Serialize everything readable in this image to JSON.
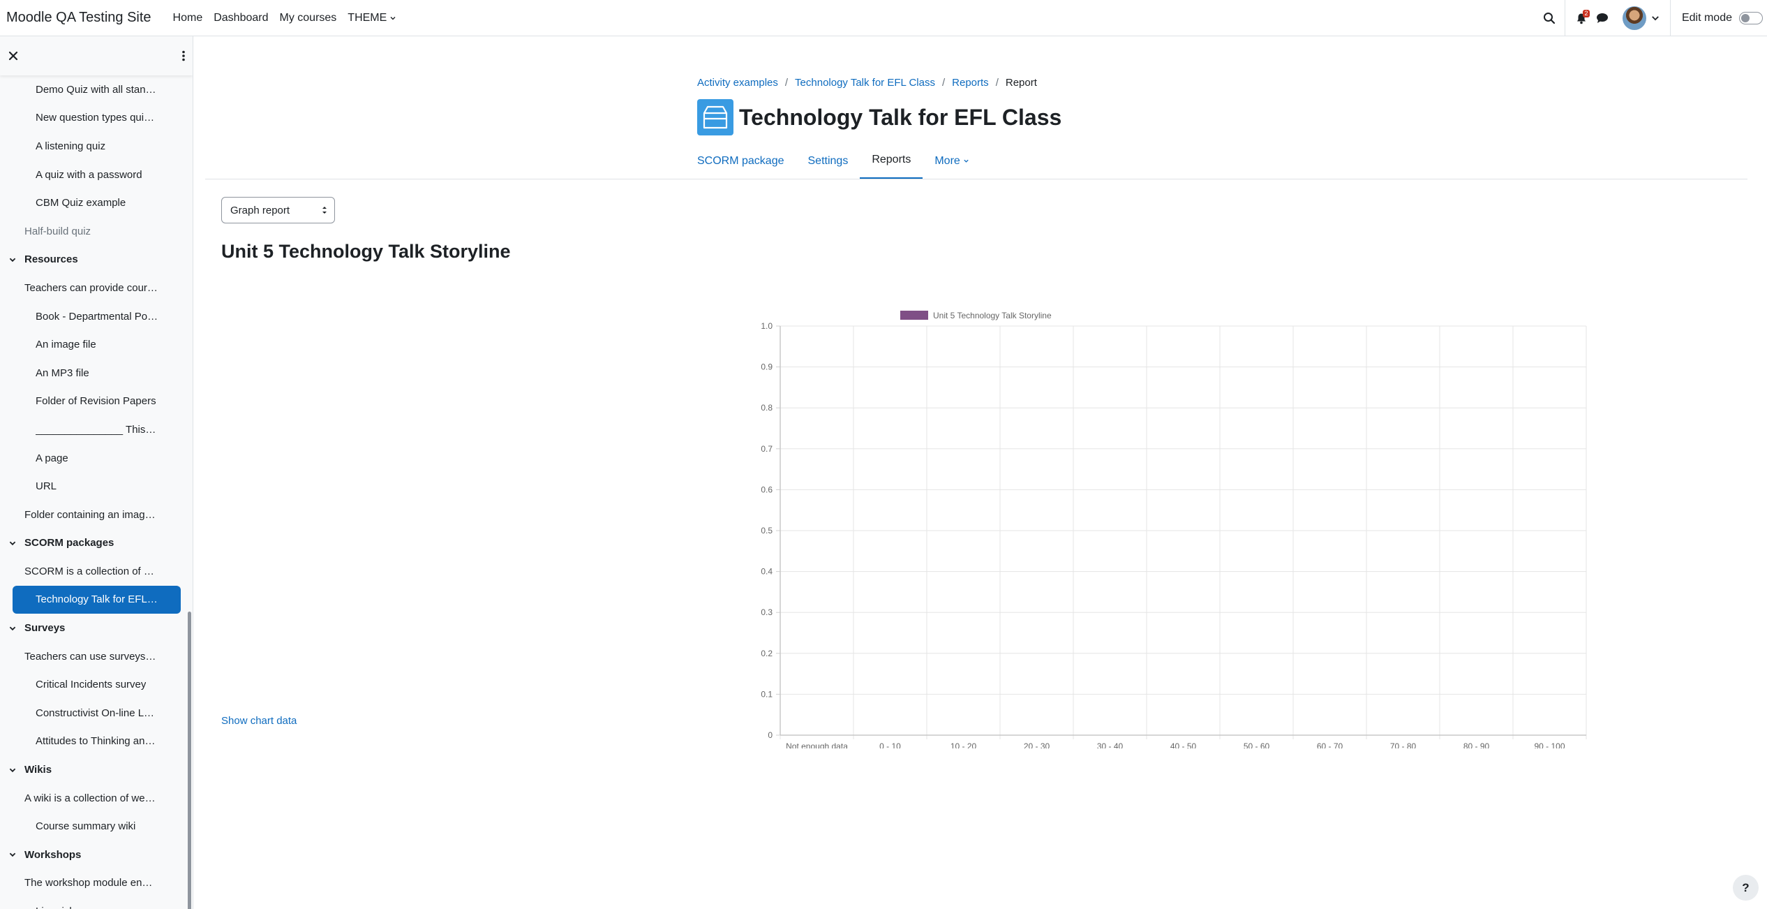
{
  "navbar": {
    "site_name": "Moodle QA Testing Site",
    "links": [
      "Home",
      "Dashboard",
      "My courses"
    ],
    "theme_label": "THEME",
    "notification_count": "2",
    "edit_mode_label": "Edit mode"
  },
  "course_index": {
    "items": [
      {
        "label": "Demo Quiz with all stan…",
        "type": "activity"
      },
      {
        "label": "New question types qui…",
        "type": "activity"
      },
      {
        "label": "A listening quiz",
        "type": "activity"
      },
      {
        "label": "A quiz with a password",
        "type": "activity"
      },
      {
        "label": "CBM Quiz example",
        "type": "activity"
      },
      {
        "label": "Half-build quiz",
        "type": "activity-muted"
      },
      {
        "label": "Resources",
        "type": "section"
      },
      {
        "label": "Teachers can provide cour…",
        "type": "summary"
      },
      {
        "label": "Book - Departmental Po…",
        "type": "activity"
      },
      {
        "label": "An image file",
        "type": "activity"
      },
      {
        "label": "An MP3 file",
        "type": "activity"
      },
      {
        "label": "Folder of Revision Papers",
        "type": "activity"
      },
      {
        "label": "_______________ This…",
        "type": "activity"
      },
      {
        "label": "A page",
        "type": "activity"
      },
      {
        "label": "URL",
        "type": "activity"
      },
      {
        "label": "Folder containing an imag…",
        "type": "summary"
      },
      {
        "label": "SCORM packages",
        "type": "section"
      },
      {
        "label": "SCORM is a collection of …",
        "type": "summary"
      },
      {
        "label": "Technology Talk for EFL…",
        "type": "active"
      },
      {
        "label": "Surveys",
        "type": "section"
      },
      {
        "label": "Teachers can use surveys…",
        "type": "summary"
      },
      {
        "label": "Critical Incidents survey",
        "type": "activity"
      },
      {
        "label": "Constructivist On-line L…",
        "type": "activity"
      },
      {
        "label": "Attitudes to Thinking an…",
        "type": "activity"
      },
      {
        "label": "Wikis",
        "type": "section"
      },
      {
        "label": "A wiki is a collection of we…",
        "type": "summary"
      },
      {
        "label": "Course summary wiki",
        "type": "activity"
      },
      {
        "label": "Workshops",
        "type": "section"
      },
      {
        "label": "The workshop module en…",
        "type": "summary"
      },
      {
        "label": "Limericks",
        "type": "activity"
      }
    ]
  },
  "breadcrumb": [
    "Activity examples",
    "Technology Talk for EFL Class",
    "Reports"
  ],
  "breadcrumb_current": "Report",
  "page": {
    "title": "Technology Talk for EFL Class",
    "tabs": [
      {
        "label": "SCORM package",
        "active": false
      },
      {
        "label": "Settings",
        "active": false
      },
      {
        "label": "Reports",
        "active": true
      },
      {
        "label": "More",
        "active": false
      }
    ],
    "report_select_value": "Graph report",
    "report_title": "Unit 5 Technology Talk Storyline",
    "show_chart_data": "Show chart data",
    "help_label": "?"
  },
  "colors": {
    "brand_blue": "#0f6cbf",
    "series_purple": "#7f4f86",
    "activity_icon_blue": "#399be2"
  },
  "chart_data": {
    "type": "bar",
    "categories": [
      "Not enough data",
      "0 - 10",
      "10 - 20",
      "20 - 30",
      "30 - 40",
      "40 - 50",
      "50 - 60",
      "60 - 70",
      "70 - 80",
      "80 - 90",
      "90 - 100"
    ],
    "series": [
      {
        "name": "Unit 5 Technology Talk Storyline",
        "values": [
          0,
          0,
          0,
          0,
          0,
          0,
          0,
          0,
          0,
          0,
          0
        ],
        "color": "#7f4f86"
      }
    ],
    "yticks": [
      "0",
      "0.1",
      "0.2",
      "0.3",
      "0.4",
      "0.5",
      "0.6",
      "0.7",
      "0.8",
      "0.9",
      "1.0"
    ],
    "ylim": [
      0,
      1
    ],
    "grid": true,
    "legend_position": "top"
  }
}
